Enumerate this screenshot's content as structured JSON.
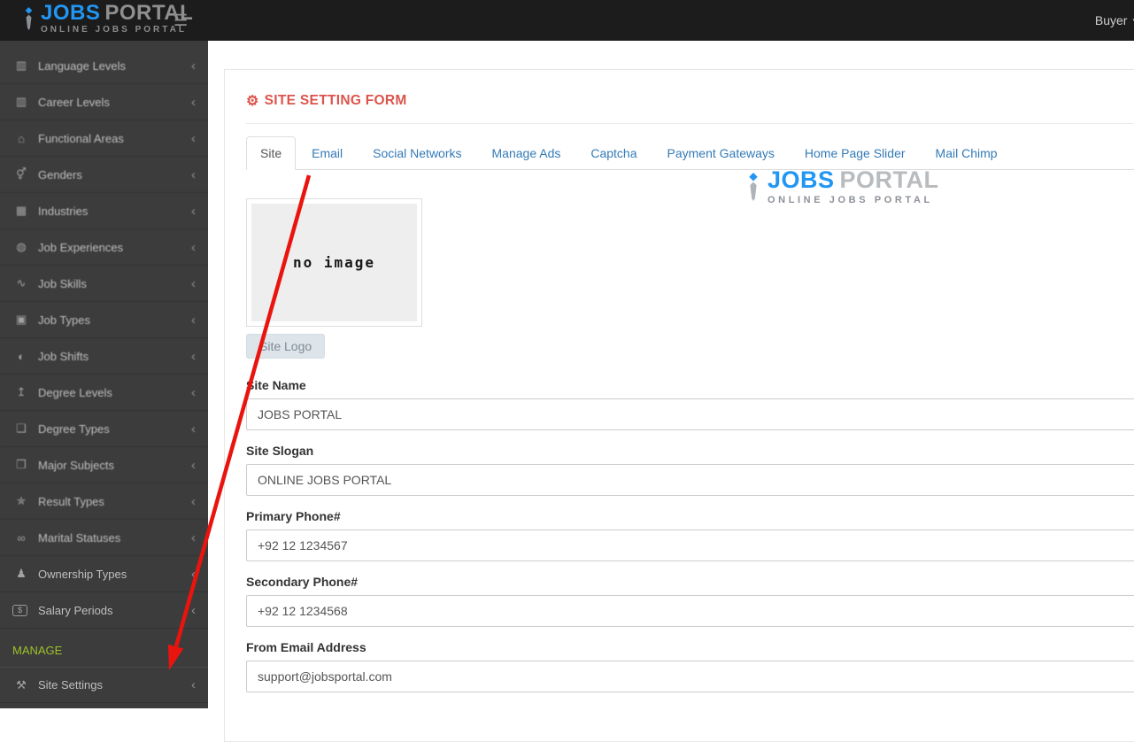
{
  "header": {
    "brand": {
      "primary": "JOBS",
      "secondary": "PORTAL",
      "tagline": "ONLINE JOBS PORTAL"
    },
    "user_menu": "Buyer"
  },
  "sidebar": {
    "items": [
      {
        "label": "Language Levels",
        "icon": "bar-chart-icon"
      },
      {
        "label": "Career Levels",
        "icon": "bar-chart-icon"
      },
      {
        "label": "Functional Areas",
        "icon": "bank-icon"
      },
      {
        "label": "Genders",
        "icon": "genders-icon"
      },
      {
        "label": "Industries",
        "icon": "building-icon"
      },
      {
        "label": "Job Experiences",
        "icon": "globe-icon"
      },
      {
        "label": "Job Skills",
        "icon": "skills-chart-icon"
      },
      {
        "label": "Job Types",
        "icon": "briefcase-icon"
      },
      {
        "label": "Job Shifts",
        "icon": "shift-icon"
      },
      {
        "label": "Degree Levels",
        "icon": "degree-level-icon"
      },
      {
        "label": "Degree Types",
        "icon": "document-icon"
      },
      {
        "label": "Major Subjects",
        "icon": "book-icon"
      },
      {
        "label": "Result Types",
        "icon": "grad-cap-icon"
      },
      {
        "label": "Marital Statuses",
        "icon": "rings-icon"
      },
      {
        "label": "Ownership Types",
        "icon": "person-icon"
      },
      {
        "label": "Salary Periods",
        "icon": "dollar-badge-icon"
      }
    ],
    "section_label": "MANAGE",
    "manage_items": [
      {
        "label": "Site Settings",
        "icon": "wrench-icon"
      }
    ]
  },
  "page": {
    "title": "SITE SETTING FORM"
  },
  "tabs": {
    "active": "Site",
    "items": [
      "Site",
      "Email",
      "Social Networks",
      "Manage Ads",
      "Captcha",
      "Payment Gateways",
      "Home Page Slider",
      "Mail Chimp"
    ]
  },
  "form": {
    "image_placeholder": "no image",
    "upload_button": "Site Logo",
    "fields": [
      {
        "label": "Site Name",
        "value": "JOBS PORTAL"
      },
      {
        "label": "Site Slogan",
        "value": "ONLINE JOBS PORTAL"
      },
      {
        "label": "Primary Phone#",
        "value": "+92 12 1234567"
      },
      {
        "label": "Secondary Phone#",
        "value": "+92 12 1234568"
      },
      {
        "label": "From Email Address",
        "value": "support@jobsportal.com"
      }
    ]
  },
  "content_logo": {
    "primary": "JOBS",
    "secondary": "PORTAL",
    "tagline": "ONLINE JOBS PORTAL"
  },
  "annotation": {
    "color": "#ea140f"
  },
  "colors": {
    "accent_blue": "#2196f3",
    "tab_link_blue": "#337ab7",
    "heading_red": "#dc544b",
    "manage_green": "#9dc229",
    "header_bg": "#1c1c1c",
    "sidebar_bg": "#3c3c3c"
  }
}
